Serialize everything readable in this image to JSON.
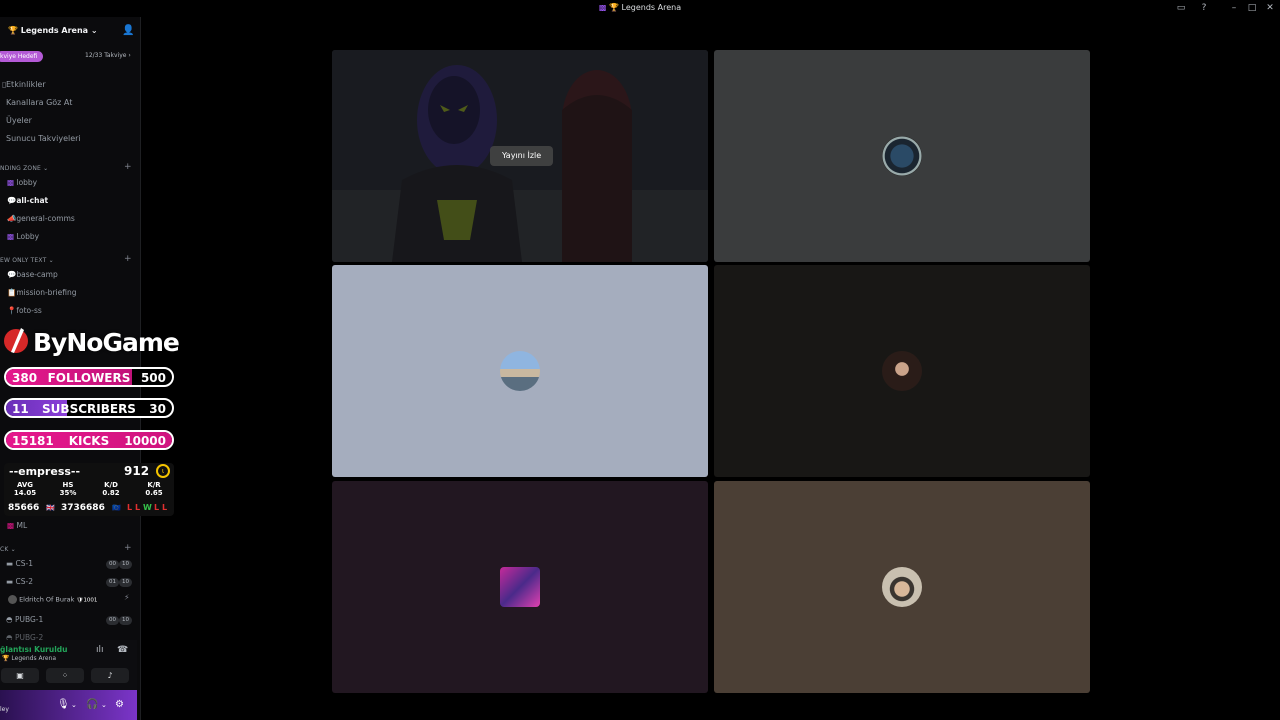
{
  "titlebar": {
    "title": "Legends Arena",
    "icon_1": "dice-icon",
    "icon_2": "trophy-icon"
  },
  "server": {
    "name": "Legends Arena",
    "boost_goal": "kviye Hedefi",
    "boost_count": "12/33 Takviye ›"
  },
  "nav": [
    "Etkinlikler",
    "Kanallara Göz At",
    "Üyeler",
    "Sunucu Takviyeleri"
  ],
  "categories": {
    "landing": "NDING ZONE ⌄",
    "view_only": "EW ONLY TEXT ⌄",
    "pick": "CK ⌄"
  },
  "landing_channels": [
    "lobby",
    "all-chat",
    "general-comms",
    "Lobby"
  ],
  "view_only_channels": [
    "base-camp",
    "mission-briefing",
    "foto-ss"
  ],
  "other_channels": [
    "ML"
  ],
  "voice_channels": [
    {
      "name": "CS-1",
      "a": "00",
      "b": "10"
    },
    {
      "name": "CS-2",
      "a": "01",
      "b": "10"
    },
    {
      "name": "PUBG-1",
      "a": "00",
      "b": "10"
    },
    {
      "name": "PUBG-2",
      "a": "",
      "b": ""
    }
  ],
  "voice_member": {
    "name": "Eldritch Of Burak",
    "badge": "1001"
  },
  "voice_panel": {
    "status": "ğlantısı Kuruldu",
    "server": "Legends Arena"
  },
  "user": {
    "name": "ley"
  },
  "overlay": {
    "brand": "ByNoGame",
    "followers": {
      "current": "380",
      "label": "FOLLOWERS",
      "goal": "500",
      "progress": 0.76
    },
    "subscribers": {
      "current": "11",
      "label": "SUBSCRIBERS",
      "goal": "30",
      "progress": 0.37
    },
    "kicks": {
      "current": "15181",
      "label": "KICKS",
      "goal": "10000",
      "progress": 1.0
    },
    "stats": {
      "nickname": "--empress--",
      "elo": "912",
      "avg_label": "AVG",
      "avg": "14.05",
      "hs_label": "HS",
      "hs": "35%",
      "kd_label": "K/D",
      "kd": "0.82",
      "kr_label": "K/R",
      "kr": "0.65",
      "left_num": "85666",
      "right_num": "3736686",
      "results": [
        "L",
        "L",
        "W",
        "L",
        "L"
      ]
    }
  },
  "stage": {
    "watch_label": "Yayını İzle"
  },
  "colors": {
    "accent": "#a35cff",
    "online": "#23a55a",
    "pink": "#e5178c",
    "purple": "#6a2fb8"
  }
}
